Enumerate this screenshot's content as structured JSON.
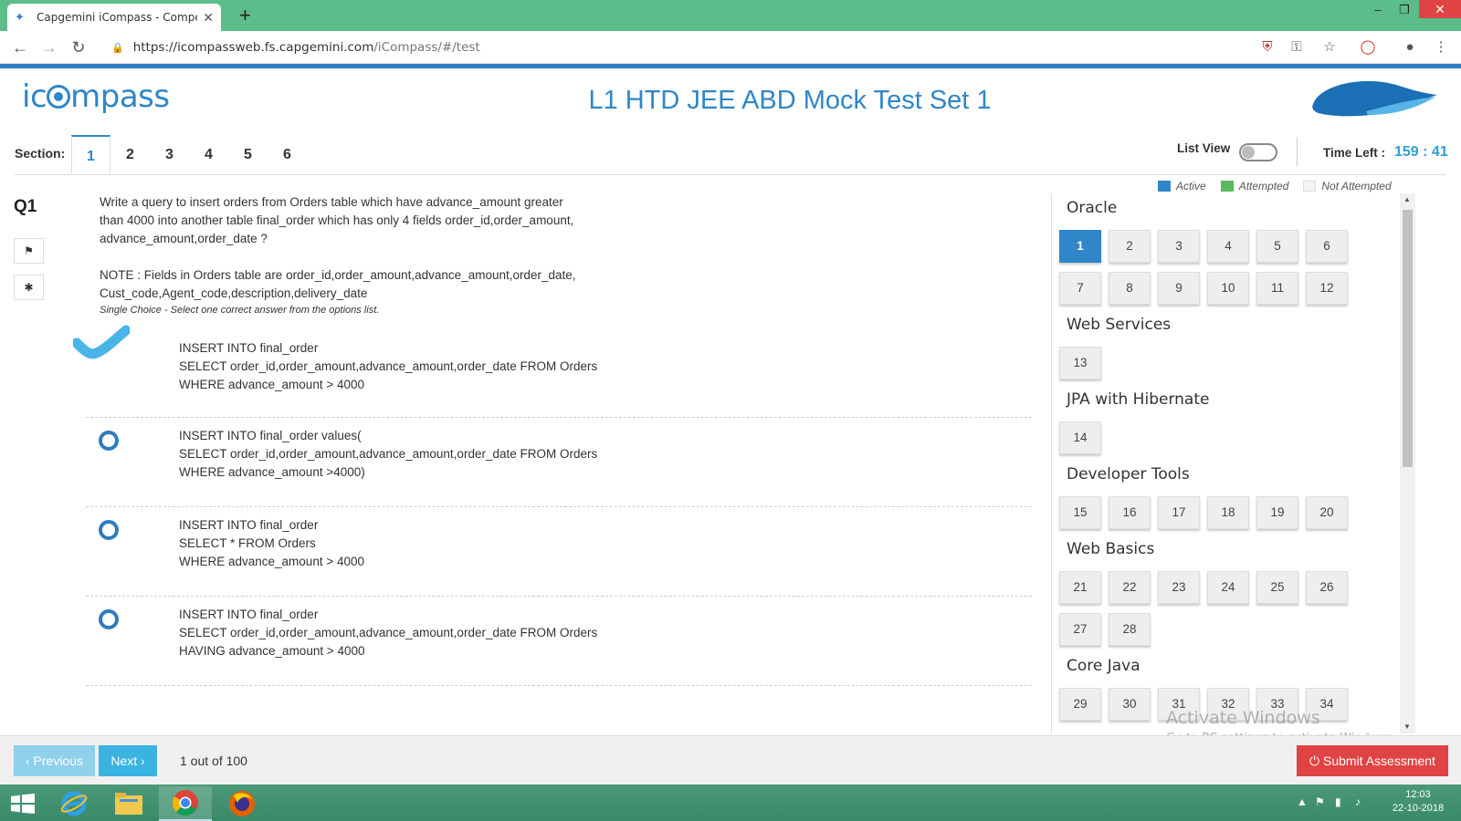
{
  "browser": {
    "tab_title": "Capgemini iCompass - Competen",
    "url_host": "https://icompassweb.fs.capgemini.com",
    "url_path": "/iCompass/#/test"
  },
  "app": {
    "logo_text": "icompass",
    "test_title": "L1 HTD JEE ABD Mock Test Set 1"
  },
  "sections": {
    "label": "Section:",
    "tabs": [
      "1",
      "2",
      "3",
      "4",
      "5",
      "6"
    ],
    "active": "1"
  },
  "header_right": {
    "list_view_label": "List View",
    "list_view_on": false,
    "time_left_label": "Time Left :",
    "time_left_value": "159 : 41"
  },
  "legend": [
    {
      "label": "Active",
      "color": "#2f86c8"
    },
    {
      "label": "Attempted",
      "color": "#5cb85c"
    },
    {
      "label": "Not Attempted",
      "color": "#f4f4f4"
    }
  ],
  "question": {
    "number": "Q1",
    "text": "Write a query to insert orders from Orders table which have advance_amount greater\nthan 4000 into another table final_order which has only 4 fields order_id,order_amount,\nadvance_amount,order_date ?\n\nNOTE : Fields in Orders table are order_id,order_amount,advance_amount,order_date,\nCust_code,Agent_code,description,delivery_date",
    "hint": "Single Choice - Select one correct answer from the options list.",
    "options": [
      {
        "text": "INSERT INTO final_order\nSELECT order_id,order_amount,advance_amount,order_date FROM Orders\nWHERE advance_amount > 4000",
        "selected": true
      },
      {
        "text": "INSERT INTO final_order values(\nSELECT order_id,order_amount,advance_amount,order_date FROM Orders\nWHERE advance_amount >4000)",
        "selected": false
      },
      {
        "text": "INSERT INTO final_order\nSELECT * FROM Orders\nWHERE advance_amount > 4000",
        "selected": false
      },
      {
        "text": "INSERT INTO final_order\nSELECT order_id,order_amount,advance_amount,order_date FROM Orders\nHAVING advance_amount > 4000",
        "selected": false
      }
    ]
  },
  "question_groups": [
    {
      "title": "Oracle",
      "questions": [
        "1",
        "2",
        "3",
        "4",
        "5",
        "6",
        "7",
        "8",
        "9",
        "10",
        "11",
        "12"
      ]
    },
    {
      "title": "Web Services",
      "questions": [
        "13"
      ]
    },
    {
      "title": "JPA with Hibernate",
      "questions": [
        "14"
      ]
    },
    {
      "title": "Developer Tools",
      "questions": [
        "15",
        "16",
        "17",
        "18",
        "19",
        "20"
      ]
    },
    {
      "title": "Web Basics",
      "questions": [
        "21",
        "22",
        "23",
        "24",
        "25",
        "26",
        "27",
        "28"
      ]
    },
    {
      "title": "Core Java",
      "questions": [
        "29",
        "30",
        "31",
        "32",
        "33",
        "34"
      ]
    }
  ],
  "active_question": "1",
  "watermark": {
    "line1": "Activate Windows",
    "line2": "Go to PC settings to activate Windows."
  },
  "footer": {
    "previous_label": "‹ Previous",
    "next_label": "Next ›",
    "progress": "1 out of 100",
    "submit_label": "⏻ Submit Assessment"
  },
  "taskbar": {
    "time": "12:03",
    "date": "22-10-2018"
  }
}
